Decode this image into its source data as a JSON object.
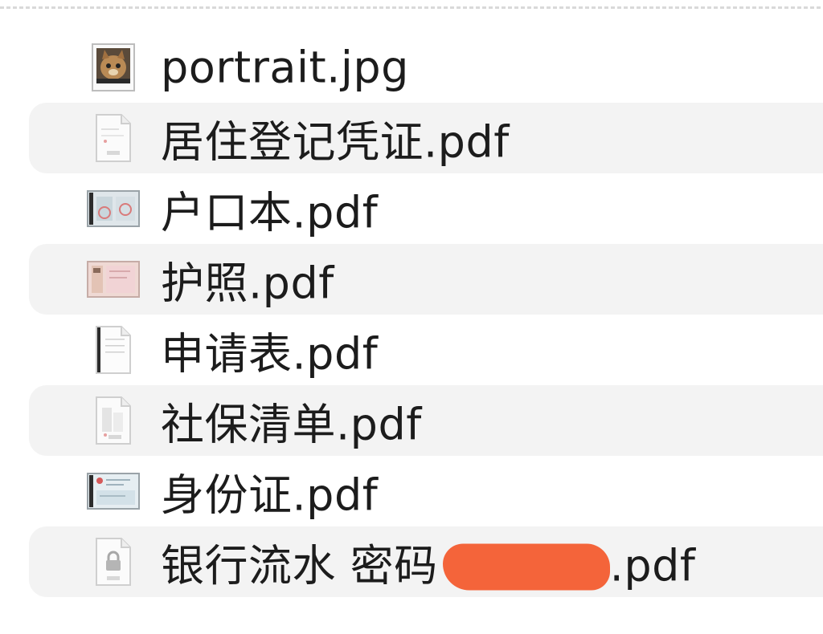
{
  "files": [
    {
      "name": "portrait.jpg",
      "icon": "image-thumbnail-icon"
    },
    {
      "name": "居住登记凭证.pdf",
      "icon": "pdf-document-icon"
    },
    {
      "name": "户口本.pdf",
      "icon": "pdf-thumbnail-icon"
    },
    {
      "name": "护照.pdf",
      "icon": "pdf-thumbnail-icon"
    },
    {
      "name": "申请表.pdf",
      "icon": "pdf-document-icon"
    },
    {
      "name": "社保清单.pdf",
      "icon": "pdf-document-icon"
    },
    {
      "name": "身份证.pdf",
      "icon": "pdf-thumbnail-icon"
    },
    {
      "name_prefix": "银行流水 密码",
      "name_suffix": ".pdf",
      "icon": "locked-pdf-icon"
    }
  ],
  "colors": {
    "row_stripe": "#f3f3f3",
    "text": "#1c1c1c",
    "redaction": "#f4643a"
  }
}
